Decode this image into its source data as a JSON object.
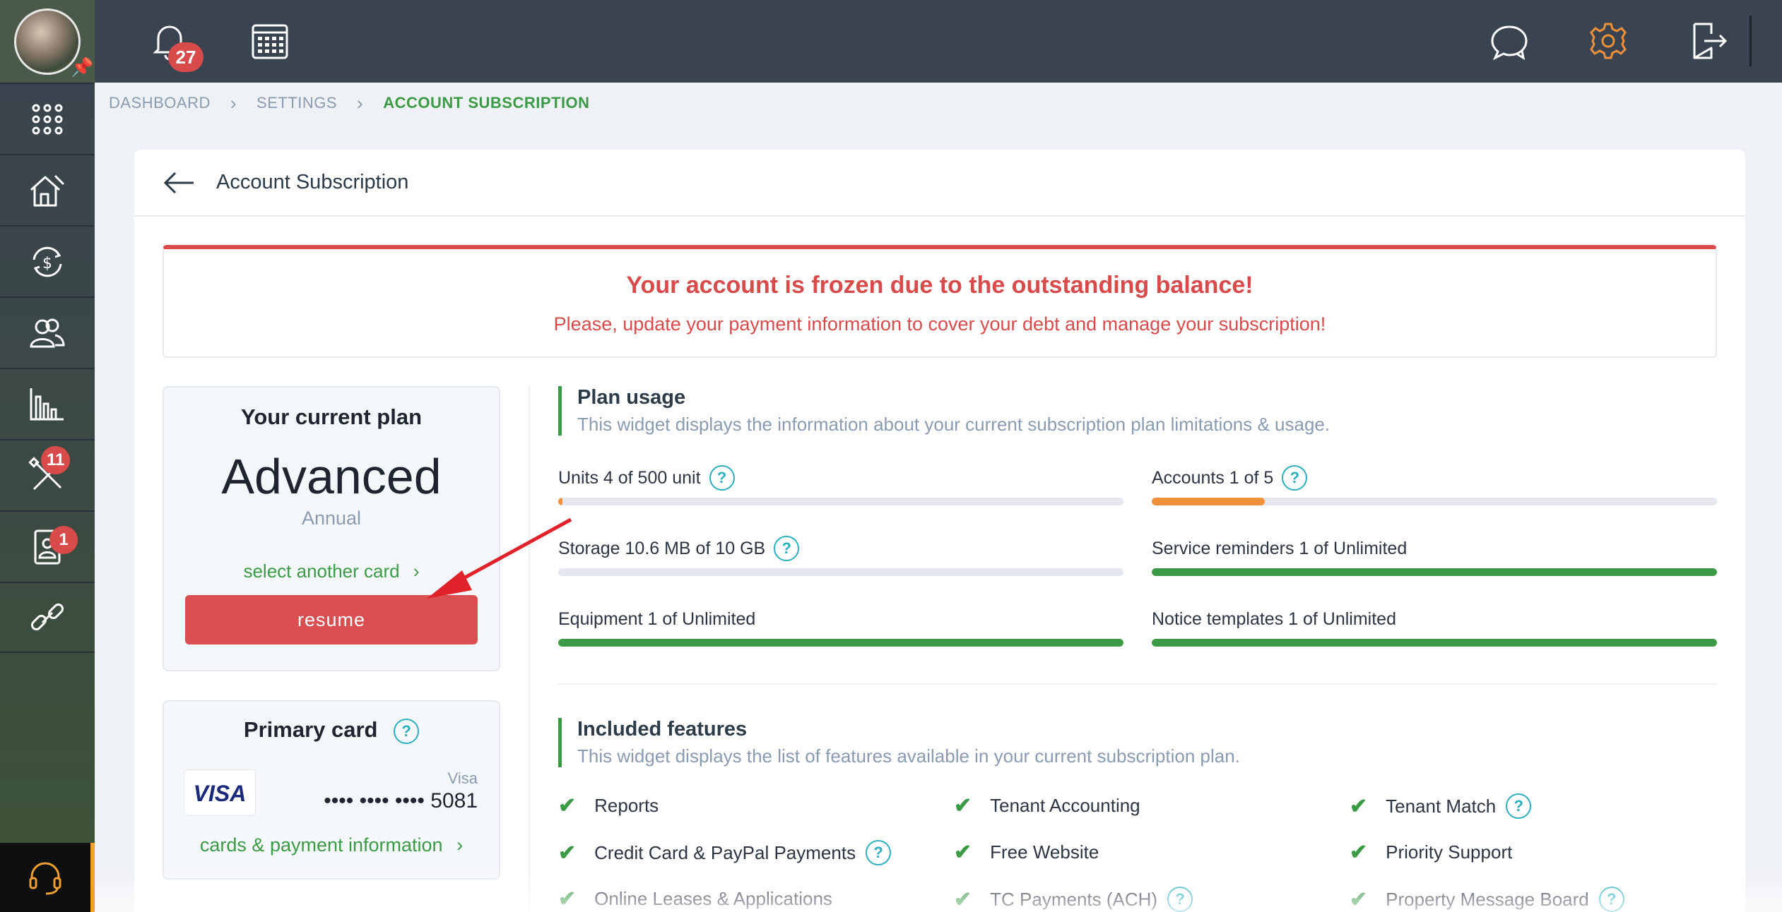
{
  "sidebar": {
    "badges": {
      "tools": "11",
      "tenant": "1"
    }
  },
  "topbar": {
    "notifications_count": "27",
    "accent_color": "#f0903a"
  },
  "breadcrumb": {
    "items": [
      "DASHBOARD",
      "SETTINGS",
      "ACCOUNT SUBSCRIPTION"
    ]
  },
  "page": {
    "title": "Account Subscription"
  },
  "alert": {
    "title": "Your account is frozen due to the outstanding balance!",
    "message": "Please, update your payment information to cover your debt and manage your subscription!"
  },
  "plan": {
    "heading": "Your current plan",
    "name": "Advanced",
    "period": "Annual",
    "select_card_link": "select another card",
    "resume_label": "resume"
  },
  "primary_card": {
    "heading": "Primary card",
    "logo_text": "VISA",
    "brand": "Visa",
    "number": "•••• •••• •••• 5081",
    "link": "cards & payment information"
  },
  "usage": {
    "title": "Plan usage",
    "subtitle": "This widget displays the information about your current subscription plan limitations & usage.",
    "metrics": [
      {
        "label": "Units 4 of 500 unit",
        "fraction": 0.008,
        "color": "#f0903a",
        "help": true
      },
      {
        "label": "Accounts 1 of 5",
        "fraction": 0.2,
        "color": "#f0903a",
        "help": true
      },
      {
        "label": "Storage 10.6 MB of 10 GB",
        "fraction": 0.0,
        "color": "#f0903a",
        "help": true
      },
      {
        "label": "Service reminders 1 of Unlimited",
        "fraction": 1.0,
        "color": "#3a9a45",
        "help": false
      },
      {
        "label": "Equipment 1 of Unlimited",
        "fraction": 1.0,
        "color": "#3a9a45",
        "help": false
      },
      {
        "label": "Notice templates 1 of Unlimited",
        "fraction": 1.0,
        "color": "#3a9a45",
        "help": false
      }
    ]
  },
  "features": {
    "title": "Included features",
    "subtitle": "This widget displays the list of features available in your current subscription plan.",
    "items": [
      {
        "label": "Reports",
        "help": false
      },
      {
        "label": "Tenant Accounting",
        "help": false
      },
      {
        "label": "Tenant Match",
        "help": true
      },
      {
        "label": "Credit Card & PayPal Payments",
        "help": true
      },
      {
        "label": "Free Website",
        "help": false
      },
      {
        "label": "Priority Support",
        "help": false
      },
      {
        "label": "Online Leases & Applications",
        "help": false
      },
      {
        "label": "TC Payments (ACH)",
        "help": true
      },
      {
        "label": "Property Message Board",
        "help": true
      }
    ]
  },
  "help_glyph": "?",
  "check_glyph": "✔"
}
